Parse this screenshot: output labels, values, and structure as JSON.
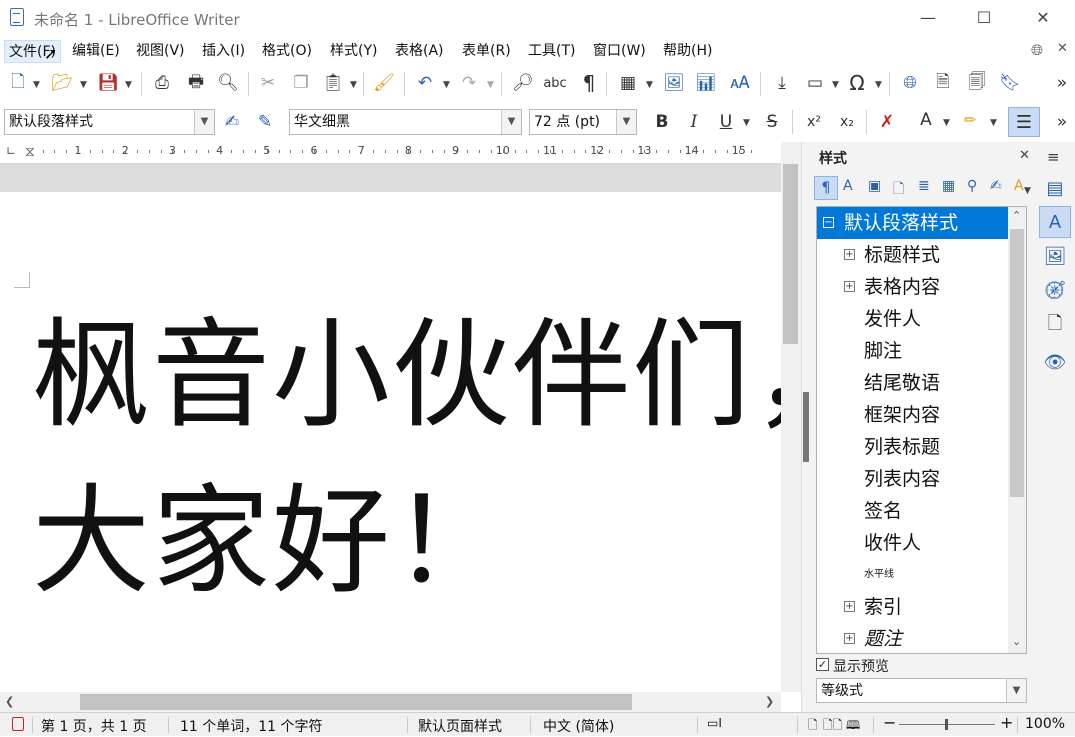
{
  "window": {
    "title": "未命名 1 - LibreOffice Writer",
    "minimize": "—",
    "maximize": "☐",
    "close": "✕"
  },
  "menu": [
    "文件(F)",
    "编辑(E)",
    "视图(V)",
    "插入(I)",
    "格式(O)",
    "样式(Y)",
    "表格(A)",
    "表单(R)",
    "工具(T)",
    "窗口(W)",
    "帮助(H)"
  ],
  "active_menu": "文件(F)",
  "formatting": {
    "paragraph_style": "默认段落样式",
    "font_name": "华文细黑",
    "font_size": "72 点 (pt)",
    "bold": "B",
    "italic": "I",
    "underline": "U",
    "strike": "S",
    "superscript": "x²",
    "subscript": "x₂",
    "more": "»"
  },
  "ruler": {
    "numbers": [
      "1",
      "2",
      "3",
      "4",
      "5",
      "6",
      "7",
      "8",
      "9",
      "10",
      "11",
      "12",
      "13",
      "14",
      "15"
    ]
  },
  "document": {
    "line1": "枫音小伙伴们，",
    "line2": "大家好！"
  },
  "sidebar": {
    "title": "样式",
    "close": "✕",
    "menu": "≡",
    "styles": [
      {
        "label": "默认段落样式",
        "expandable": true,
        "selected": true
      },
      {
        "label": "标题样式",
        "expandable": true,
        "selected": false
      },
      {
        "label": "表格内容",
        "expandable": true,
        "selected": false
      },
      {
        "label": "发件人",
        "expandable": false,
        "selected": false
      },
      {
        "label": "脚注",
        "expandable": false,
        "selected": false
      },
      {
        "label": "结尾敬语",
        "expandable": false,
        "selected": false
      },
      {
        "label": "框架内容",
        "expandable": false,
        "selected": false
      },
      {
        "label": "列表标题",
        "expandable": false,
        "selected": false
      },
      {
        "label": "列表内容",
        "expandable": false,
        "selected": false
      },
      {
        "label": "签名",
        "expandable": false,
        "selected": false
      },
      {
        "label": "收件人",
        "expandable": false,
        "selected": false
      },
      {
        "label": "水平线",
        "expandable": false,
        "selected": false
      },
      {
        "label": "索引",
        "expandable": true,
        "selected": false
      },
      {
        "label": "题注",
        "expandable": true,
        "selected": false
      }
    ],
    "show_preview_label": "显示预览",
    "show_preview_checked": true,
    "filter": "等级式"
  },
  "status": {
    "page": "第 1 页，共 1 页",
    "words": "11 个单词，11 个字符",
    "page_style": "默认页面样式",
    "language": "中文 (简体)",
    "zoom": "100%"
  },
  "colors": {
    "accent": "#0078d7",
    "font_color": "#c9211e",
    "highlight": "#ffff00"
  }
}
